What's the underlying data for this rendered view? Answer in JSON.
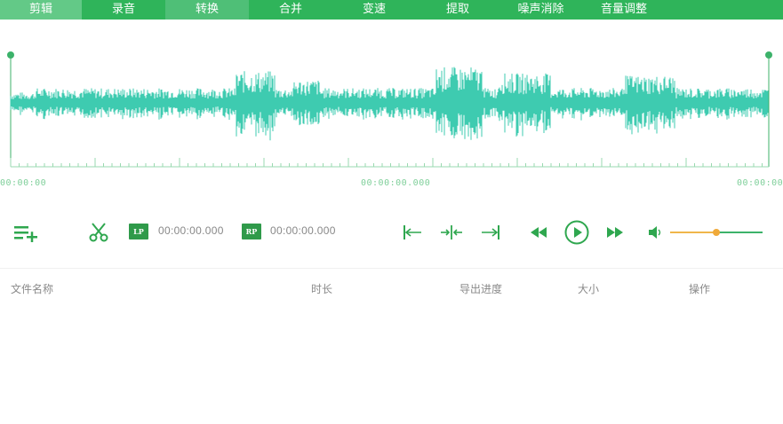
{
  "tabs": [
    {
      "label": "剪辑",
      "name": "tab-cut",
      "state": "active"
    },
    {
      "label": "录音",
      "name": "tab-record",
      "state": ""
    },
    {
      "label": "转换",
      "name": "tab-convert",
      "state": "hl"
    },
    {
      "label": "合并",
      "name": "tab-merge",
      "state": ""
    },
    {
      "label": "变速",
      "name": "tab-speed",
      "state": ""
    },
    {
      "label": "提取",
      "name": "tab-extract",
      "state": ""
    },
    {
      "label": "噪声消除",
      "name": "tab-noise",
      "state": ""
    },
    {
      "label": "音量调整",
      "name": "tab-volume",
      "state": ""
    }
  ],
  "timeline": {
    "start": "00:00:00",
    "middle": "00:00:00.000",
    "end": "00:00:00"
  },
  "controls": {
    "add_icon": "add-list-icon",
    "cut_icon": "scissors-icon",
    "left_point": {
      "badge": "LP",
      "time": "00:00:00.000"
    },
    "right_point": {
      "badge": "RP",
      "time": "00:00:00.000"
    },
    "volume_level": 0.5
  },
  "table": {
    "columns": [
      "文件名称",
      "时长",
      "导出进度",
      "大小",
      "操作"
    ]
  },
  "colors": {
    "accent": "#2fb45a",
    "wave": "#3ecbb0",
    "volume": "#f0b64a"
  }
}
